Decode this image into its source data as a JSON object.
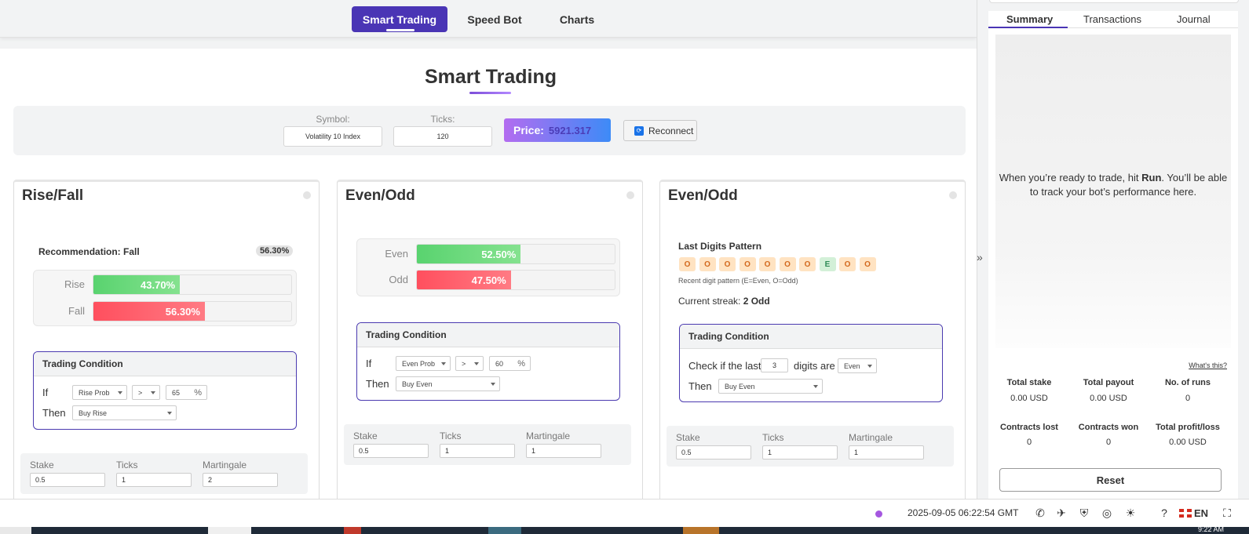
{
  "nav": {
    "tabs": [
      "Smart Trading",
      "Speed Bot",
      "Charts"
    ],
    "active": "Smart Trading"
  },
  "page": {
    "title": "Smart Trading"
  },
  "controls": {
    "symbol_label": "Symbol:",
    "symbol_value": "Volatility 10 Index",
    "ticks_label": "Ticks:",
    "ticks_value": "120",
    "price_label": "Price:",
    "price_value": "5921.317",
    "reconnect_label": "Reconnect"
  },
  "rise_fall": {
    "title": "Rise/Fall",
    "recommendation": "Recommendation: Fall",
    "recommendation_pct": "56.30%",
    "bars": [
      {
        "label": "Rise",
        "value": "43.70%",
        "fraction": 0.437,
        "color": "#59d36f"
      },
      {
        "label": "Fall",
        "value": "56.30%",
        "fraction": 0.563,
        "color": "#ff4f5e"
      }
    ],
    "condition": {
      "header": "Trading Condition",
      "if_label": "If",
      "metric": "Rise Prob",
      "operator": ">",
      "threshold": "65",
      "unit": "%",
      "then_label": "Then",
      "action": "Buy Rise"
    },
    "stake": {
      "stake_label": "Stake",
      "stake": "0.5",
      "ticks_label": "Ticks",
      "ticks": "1",
      "martingale_label": "Martingale",
      "martingale": "2"
    }
  },
  "even_odd_1": {
    "title": "Even/Odd",
    "bars": [
      {
        "label": "Even",
        "value": "52.50%",
        "fraction": 0.525,
        "color": "#59d36f"
      },
      {
        "label": "Odd",
        "value": "47.50%",
        "fraction": 0.475,
        "color": "#ff4f5e"
      }
    ],
    "condition": {
      "header": "Trading Condition",
      "if_label": "If",
      "metric": "Even Prob",
      "operator": ">",
      "threshold": "60",
      "unit": "%",
      "then_label": "Then",
      "action": "Buy Even"
    },
    "stake": {
      "stake_label": "Stake",
      "stake": "0.5",
      "ticks_label": "Ticks",
      "ticks": "1",
      "martingale_label": "Martingale",
      "martingale": "1"
    }
  },
  "even_odd_2": {
    "title": "Even/Odd",
    "pattern_title": "Last Digits Pattern",
    "digits": [
      "O",
      "O",
      "O",
      "O",
      "O",
      "O",
      "O",
      "E",
      "O",
      "O"
    ],
    "pattern_note": "Recent digit pattern (E=Even, O=Odd)",
    "streak_label": "Current streak:",
    "streak_value": "2 Odd",
    "condition": {
      "header": "Trading Condition",
      "check_label": "Check if the last",
      "count": "3",
      "digits_are": "digits are",
      "parity": "Even",
      "then_label": "Then",
      "action": "Buy Even"
    },
    "stake": {
      "stake_label": "Stake",
      "stake": "0.5",
      "ticks_label": "Ticks",
      "ticks": "1",
      "martingale_label": "Martingale",
      "martingale": "1"
    }
  },
  "right_panel": {
    "tabs": [
      "Summary",
      "Transactions",
      "Journal"
    ],
    "active": "Summary",
    "empty_msg_1": "When you’re ready to trade, hit ",
    "empty_msg_bold": "Run",
    "empty_msg_2": ". You’ll be able to track your bot’s performance here.",
    "whats_this": "What's this?",
    "stats": [
      {
        "label": "Total stake",
        "value": "0.00 USD"
      },
      {
        "label": "Total payout",
        "value": "0.00 USD"
      },
      {
        "label": "No. of runs",
        "value": "0"
      },
      {
        "label": "Contracts lost",
        "value": "0"
      },
      {
        "label": "Contracts won",
        "value": "0"
      },
      {
        "label": "Total profit/loss",
        "value": "0.00 USD"
      }
    ],
    "reset_label": "Reset"
  },
  "footer": {
    "timestamp": "2025-09-05 06:22:54 GMT",
    "language": "EN",
    "icons": [
      "whatsapp-icon",
      "telegram-icon",
      "shield-icon",
      "gauge-icon",
      "sun-icon",
      "help-icon",
      "fullscreen-icon"
    ]
  },
  "taskbar": {
    "time": "9:22 AM"
  }
}
